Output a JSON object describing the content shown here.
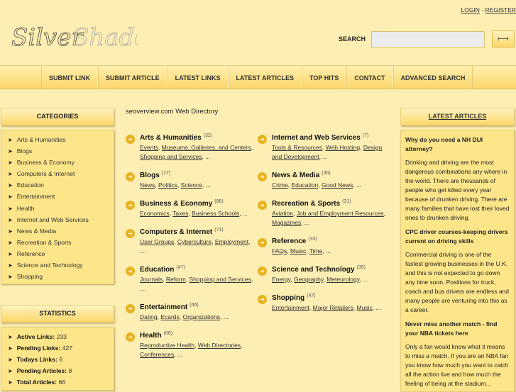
{
  "header": {
    "logo_text": "SilverShadow",
    "login": "LOGIN",
    "sep": "·",
    "register": "REGISTER",
    "search_label": "SEARCH",
    "search_value": "",
    "search_button_icon": "arrow-right-icon"
  },
  "nav": [
    "SUBMIT LINK",
    "SUBMIT ARTICLE",
    "LATEST LINKS",
    "LATEST ARTICLES",
    "TOP HITS",
    "CONTACT",
    "ADVANCED SEARCH"
  ],
  "categories": {
    "title": "CATEGORIES",
    "items": [
      "Arts & Humanities",
      "Blogs",
      "Business & Economy",
      "Computers & Internet",
      "Education",
      "Entertainment",
      "Health",
      "Internet and Web Services",
      "News & Media",
      "Recreation & Sports",
      "Reference",
      "Science and Technology",
      "Shopping"
    ]
  },
  "statistics": {
    "title": "STATISTICS",
    "items": [
      {
        "label": "Active Links:",
        "value": "233"
      },
      {
        "label": "Pending Links:",
        "value": "427"
      },
      {
        "label": "Todays Links:",
        "value": "6"
      },
      {
        "label": "Pending Articles:",
        "value": "8"
      },
      {
        "label": "Total Articles:",
        "value": "66"
      }
    ]
  },
  "directory": {
    "title": "seoverview.com Web Directory",
    "left": [
      {
        "name": "Arts & Humanities",
        "count": "(32)",
        "subs": [
          "Events",
          "Museums, Galleries, and Centers",
          "Shopping and Services"
        ]
      },
      {
        "name": "Blogs",
        "count": "(17)",
        "subs": [
          "News",
          "Politics",
          "Science"
        ]
      },
      {
        "name": "Business & Economy",
        "count": "(88)",
        "subs": [
          "Economics",
          "Taxes",
          "Business Schools"
        ]
      },
      {
        "name": "Computers & Internet",
        "count": "(71)",
        "subs": [
          "User Groups",
          "Cyberculture",
          "Employment"
        ]
      },
      {
        "name": "Education",
        "count": "(47)",
        "subs": [
          "Journals",
          "Reform",
          "Shopping and Services"
        ]
      },
      {
        "name": "Entertainment",
        "count": "(46)",
        "subs": [
          "Dating",
          "Ecards",
          "Organizations"
        ]
      },
      {
        "name": "Health",
        "count": "(66)",
        "subs": [
          "Reproductive Health",
          "Web Directories",
          "Conferences"
        ]
      }
    ],
    "right": [
      {
        "name": "Internet and Web Services",
        "count": "(7)",
        "subs": [
          "Tools & Resources",
          "Web Hosting",
          "Design and Development"
        ]
      },
      {
        "name": "News & Media",
        "count": "(36)",
        "subs": [
          "Crime",
          "Education",
          "Good News"
        ]
      },
      {
        "name": "Recreation & Sports",
        "count": "(31)",
        "subs": [
          "Aviation",
          "Job and Employment Resources",
          "Magazines"
        ]
      },
      {
        "name": "Reference",
        "count": "(33)",
        "subs": [
          "FAQs",
          "Music",
          "Time"
        ]
      },
      {
        "name": "Science and Technology",
        "count": "(35)",
        "subs": [
          "Energy",
          "Geography",
          "Meteorology"
        ]
      },
      {
        "name": "Shopping",
        "count": "(47)",
        "subs": [
          "Entertainment",
          "Major Retailers",
          "Music"
        ]
      }
    ],
    "ellipsis": "..."
  },
  "latest_articles": {
    "title": "LATEST ARTICLES",
    "items": [
      {
        "title": "Why do you need a NH DUI attorney?",
        "body": "Drinking and driving are the most dangerous combinations any where in the world. There are thousands of people who get killed every year because of drunken driving. There are many families that have lost their loved ones to drunken driving."
      },
      {
        "title": "CPC driver courses-keeping drivers current on driving skills",
        "body": "Commercial driving is one of the fastest growing businesses in the U.K. and this is not expected to go down any time soon. Positions for truck, coach and bus drivers are endless and many people are venturing into this as a career."
      },
      {
        "title": "Never miss another match - find your NBA tickets here",
        "body": "Only a fan would know what it means to miss a match. If you are an NBA fan you know how much you want to catch all the action live and how much the feeling of being at the stadium..."
      }
    ]
  }
}
